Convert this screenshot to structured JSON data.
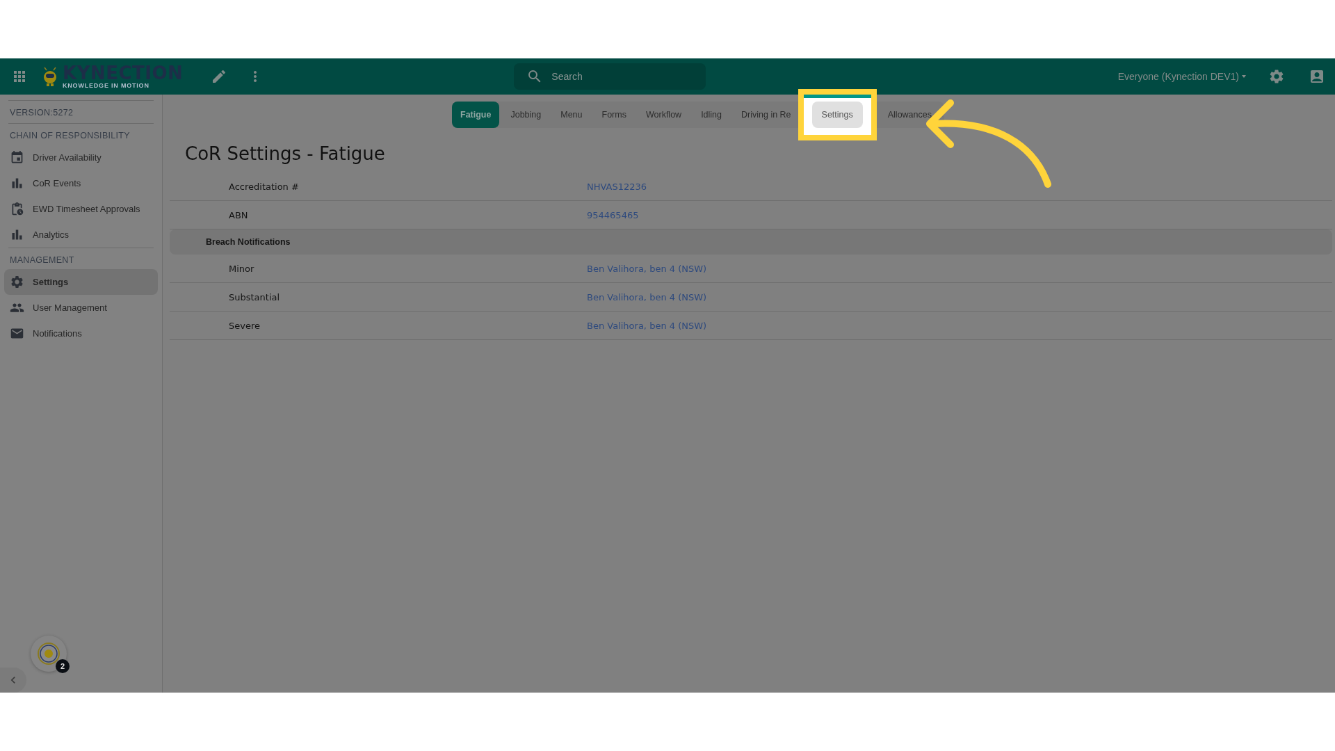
{
  "header": {
    "logo": {
      "title": "KYNECTION",
      "tagline": "KNOWLEDGE IN MOTION"
    },
    "search": {
      "placeholder": "Search"
    },
    "account": "Everyone (Kynection DEV1)"
  },
  "sidebar": {
    "version": "VERSION:5272",
    "sections": [
      {
        "heading": "CHAIN OF RESPONSIBILITY",
        "items": [
          {
            "label": "Driver Availability",
            "selected": false
          },
          {
            "label": "CoR Events",
            "selected": false
          },
          {
            "label": "EWD Timesheet Approvals",
            "selected": false
          },
          {
            "label": "Analytics",
            "selected": false
          }
        ]
      },
      {
        "heading": "MANAGEMENT",
        "items": [
          {
            "label": "Settings",
            "selected": true
          },
          {
            "label": "User Management",
            "selected": false
          },
          {
            "label": "Notifications",
            "selected": false
          }
        ]
      }
    ],
    "badge": "2"
  },
  "tabs": [
    {
      "label": "Fatigue",
      "selected": true,
      "highlighted": false
    },
    {
      "label": "Jobbing",
      "selected": false,
      "highlighted": false
    },
    {
      "label": "Menu",
      "selected": false,
      "highlighted": false
    },
    {
      "label": "Forms",
      "selected": false,
      "highlighted": false
    },
    {
      "label": "Workflow",
      "selected": false,
      "highlighted": false
    },
    {
      "label": "Idling",
      "selected": false,
      "highlighted": false
    },
    {
      "label": "Driving in Re",
      "selected": false,
      "highlighted": false
    },
    {
      "label": "Settings",
      "selected": false,
      "highlighted": true
    },
    {
      "label": "Allowances",
      "selected": false,
      "highlighted": false
    }
  ],
  "page": {
    "title": "CoR Settings - Fatigue",
    "rows": [
      {
        "kind": "field",
        "label": "Accreditation #",
        "value": "NHVAS12236"
      },
      {
        "kind": "field",
        "label": "ABN",
        "value": "954465465"
      },
      {
        "kind": "group",
        "label": "Breach Notifications"
      },
      {
        "kind": "field",
        "label": "Minor",
        "value": "Ben Valihora, ben 4 (NSW)"
      },
      {
        "kind": "field",
        "label": "Substantial",
        "value": "Ben Valihora, ben 4 (NSW)"
      },
      {
        "kind": "field",
        "label": "Severe",
        "value": "Ben Valihora, ben 4 (NSW)"
      }
    ]
  }
}
